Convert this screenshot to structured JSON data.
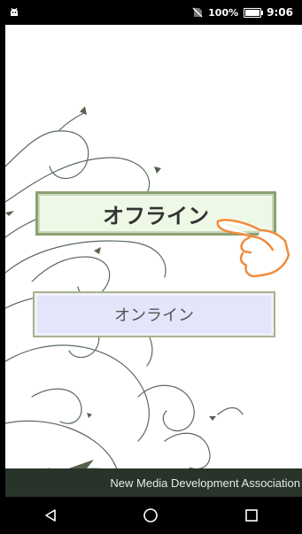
{
  "status_bar": {
    "battery": "100%",
    "time": "9:06",
    "icons": [
      "android-icon",
      "no-sim-icon",
      "battery-icon"
    ]
  },
  "main": {
    "offline_label": "オフライン",
    "online_label": "オンライン"
  },
  "footer": {
    "text": "New Media Development Association"
  },
  "nav_bar": {
    "icons": [
      "back-icon",
      "home-icon",
      "recents-icon"
    ]
  },
  "colors": {
    "offline_bg": "#eef8e6",
    "offline_border": "#8aa171",
    "online_bg": "#e3e6fa",
    "footer_bg": "#28332a",
    "hand": "#f08c3c"
  }
}
